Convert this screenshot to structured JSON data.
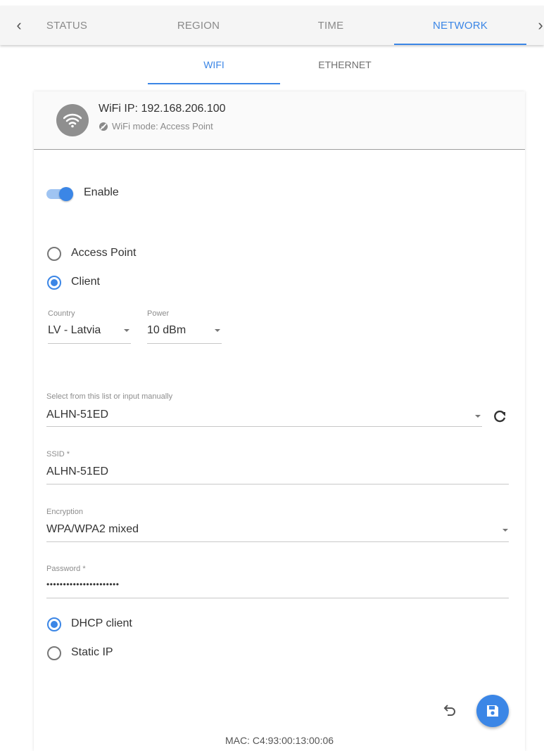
{
  "topnav": {
    "tabs": [
      "STATUS",
      "REGION",
      "TIME",
      "NETWORK"
    ],
    "active_tab": "NETWORK",
    "prev_arrow": "‹",
    "next_arrow": "›"
  },
  "subnav": {
    "tabs": [
      "WIFI",
      "ETHERNET"
    ],
    "active_tab": "WIFI"
  },
  "header": {
    "title": "WiFi IP: 192.168.206.100",
    "subtitle": "WiFi mode: Access Point",
    "avatar_icon": "wifi-icon",
    "mode_icon": "disabled-circle-icon"
  },
  "enable": {
    "label": "Enable",
    "on": true
  },
  "mode": {
    "options": [
      "Access Point",
      "Client"
    ],
    "selected": "Client"
  },
  "country": {
    "label": "Country",
    "value": "LV - Latvia"
  },
  "power": {
    "label": "Power",
    "value": "10 dBm"
  },
  "network_select": {
    "label": "Select from this list or input manually",
    "value": "ALHN-51ED"
  },
  "ssid": {
    "label": "SSID *",
    "value": "ALHN-51ED"
  },
  "encryption": {
    "label": "Encryption",
    "value": "WPA/WPA2 mixed"
  },
  "password": {
    "label": "Password *",
    "value": "••••••••••••••••••••••"
  },
  "ip_mode": {
    "options": [
      "DHCP client",
      "Static IP"
    ],
    "selected": "DHCP client"
  },
  "footer": {
    "mac": "MAC: C4:93:00:13:00:06"
  },
  "colors": {
    "accent": "#3b86e6",
    "avatar": "#8f8f8f"
  }
}
